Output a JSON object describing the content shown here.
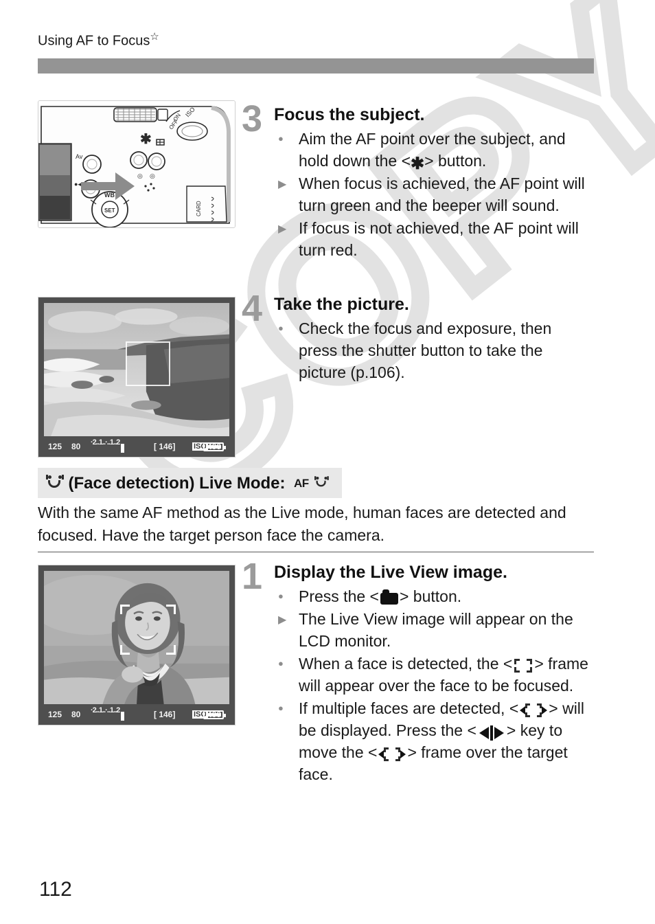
{
  "page": {
    "running_head": "Using AF to Focus",
    "running_head_marker": "☆",
    "page_number": "112",
    "watermark_text": "COPY"
  },
  "steps": [
    {
      "number": "3",
      "title": "Focus the subject.",
      "items": [
        {
          "marker": "dot",
          "parts": [
            "Aim the AF point over the subject, and hold down the <",
            "ae-lock-icon",
            "> button."
          ]
        },
        {
          "marker": "tri",
          "parts": [
            "When focus is achieved, the AF point will turn green and the beeper will sound."
          ]
        },
        {
          "marker": "tri",
          "parts": [
            "If focus is not achieved, the AF point will turn red."
          ]
        }
      ]
    },
    {
      "number": "4",
      "title": "Take the picture.",
      "items": [
        {
          "marker": "dot",
          "parts": [
            "Check the focus and exposure, then press the shutter button to take the picture (p.106)."
          ]
        }
      ]
    },
    {
      "number": "1",
      "title": "Display the Live View image.",
      "items": [
        {
          "marker": "dot",
          "parts": [
            "Press the <",
            "camera-icon",
            "> button."
          ]
        },
        {
          "marker": "tri",
          "parts": [
            "The Live View image will appear on the LCD monitor."
          ]
        },
        {
          "marker": "dot",
          "parts": [
            "When a face is detected, the <",
            "face-frame-icon",
            "> frame will appear over the face to be focused."
          ]
        },
        {
          "marker": "dot",
          "parts": [
            "If multiple faces are detected, <",
            "face-frame-arrows-icon",
            "> will be displayed. Press the <",
            "left-right-key-icon",
            "> key to move the <",
            "face-frame-arrows-icon",
            "> frame over the target face."
          ]
        }
      ]
    }
  ],
  "step3": {
    "number": "3",
    "title": "Focus the subject.",
    "b1_a": "Aim the AF point over the subject,",
    "b1_b": "and hold down the <",
    "b1_c": "> button.",
    "b2": "When focus is achieved, the AF point will turn green and the beeper will sound.",
    "b3": "If focus is not achieved, the AF point will turn red."
  },
  "step4": {
    "number": "4",
    "title": "Take the picture.",
    "b1": "Check the focus and exposure, then press the shutter button to take the picture (p.106)."
  },
  "section": {
    "title_text": "(Face detection) Live Mode:",
    "af_label": "AF",
    "paragraph": "With the same AF method as the Live mode, human faces are detected and focused. Have the target person face the camera."
  },
  "step1": {
    "number": "1",
    "title": "Display the Live View image.",
    "b1_a": "Press the <",
    "b1_b": "> button.",
    "b2": "The Live View image will appear on the LCD monitor.",
    "b3_a": "When a face is detected, the <",
    "b3_b": "> frame will appear over the face to be focused.",
    "b4_a": "If multiple faces are detected, <",
    "b4_b": "> will be displayed. Press the <",
    "b4_c": "> key to move the <",
    "b4_d": "> frame over the target face."
  },
  "figures": {
    "camera_illustration": {
      "caption": "camera rear illustration with arrow pointing at AE lock button",
      "button_marks": [
        "*",
        "ISO",
        "ON",
        "OFF",
        "WB",
        "SET"
      ]
    },
    "lcd_landscape": {
      "shutter_speed": "125",
      "aperture": "80",
      "exposure_scale": "·2..1..·..1..2",
      "shots_remaining": "[ 146]",
      "iso_label": "ISO",
      "iso_value": "400",
      "scene": "coastal cliff and beach, AF box over cliff edge"
    },
    "lcd_face": {
      "shutter_speed": "125",
      "aperture": "80",
      "exposure_scale": "·2..1..·..1..2",
      "shots_remaining": "[ 146]",
      "iso_label": "ISO",
      "iso_value": "400",
      "scene": "smiling woman with white face detection frame over her face"
    }
  },
  "colors": {
    "head_bar": "#949494",
    "step_number": "#9b9b9b",
    "bullet": "#8d8d8d",
    "section_band": "#e8e8e8",
    "watermark": "#e2e2e2",
    "rule": "#5a5a5a"
  }
}
